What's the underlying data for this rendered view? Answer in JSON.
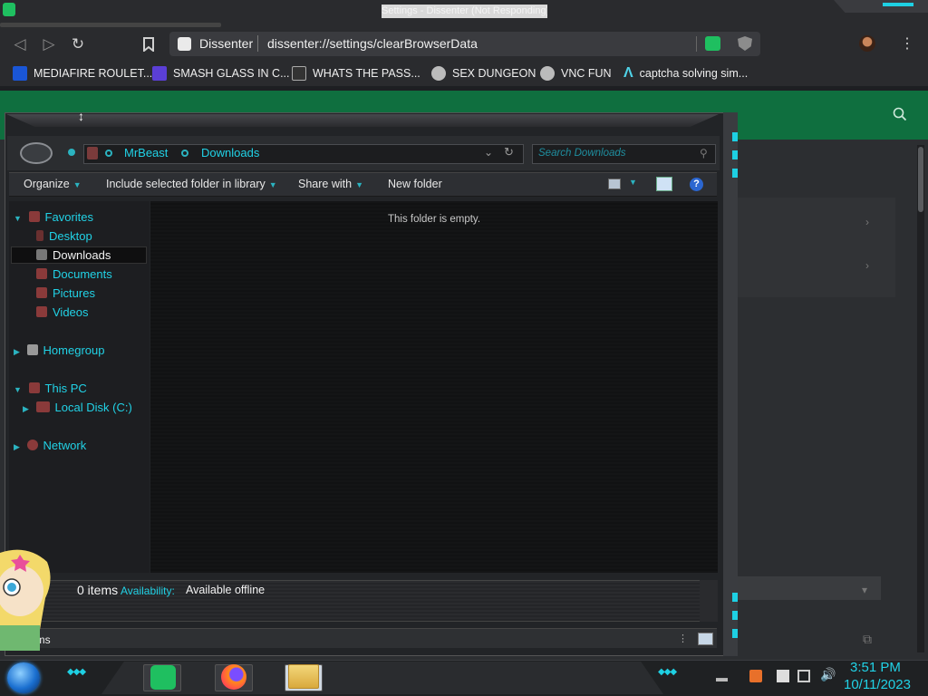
{
  "window": {
    "title": "Settings - Dissenter (Not Responding)"
  },
  "browser": {
    "site_name": "Dissenter",
    "url": "dissenter://settings/clearBrowserData",
    "icons": {
      "back": "back-arrow-icon",
      "forward": "forward-arrow-icon",
      "reload": "reload-icon",
      "bookmark": "bookmark-icon",
      "menu": "menu-icon"
    },
    "menu_glyph": "⋮",
    "bookmarks": [
      {
        "label": "MEDIAFIRE ROULET...",
        "icon": "mediafire-icon",
        "color": "#1a56d6"
      },
      {
        "label": "SMASH GLASS IN C...",
        "icon": "smash-icon",
        "color": "#5b3fd6"
      },
      {
        "label": "WHATS THE PASS...",
        "icon": "password-icon",
        "color": "#333333"
      },
      {
        "label": "SEX DUNGEON",
        "icon": "dungeon-icon",
        "color": "#bbbbbb"
      },
      {
        "label": "VNC FUN",
        "icon": "vnc-icon",
        "color": "#bbbbbb"
      },
      {
        "label": "captcha solving sim...",
        "icon": "captcha-icon",
        "color": "#4fd1e6"
      }
    ]
  },
  "explorer": {
    "breadcrumb": [
      "MrBeast",
      "Downloads"
    ],
    "search_placeholder": "Search Downloads",
    "commands": {
      "organize": "Organize",
      "include": "Include selected folder in library",
      "share": "Share with",
      "new_folder": "New folder"
    },
    "empty_message": "This folder is empty.",
    "nav": {
      "favorites": "Favorites",
      "desktop": "Desktop",
      "downloads": "Downloads",
      "documents": "Documents",
      "pictures": "Pictures",
      "videos": "Videos",
      "homegroup": "Homegroup",
      "this_pc": "This PC",
      "local_disk": "Local Disk (C:)",
      "network": "Network"
    },
    "status": {
      "count": "0 items",
      "availability_label": "Availability:",
      "availability_value": "Available offline",
      "bottom_text": "ems"
    }
  },
  "taskbar": {
    "time": "3:51 PM",
    "date": "10/11/2023"
  },
  "colors": {
    "accent_cyan": "#21d2e6",
    "settings_green": "#0f6f3f",
    "chat_green": "#1fbf60"
  }
}
